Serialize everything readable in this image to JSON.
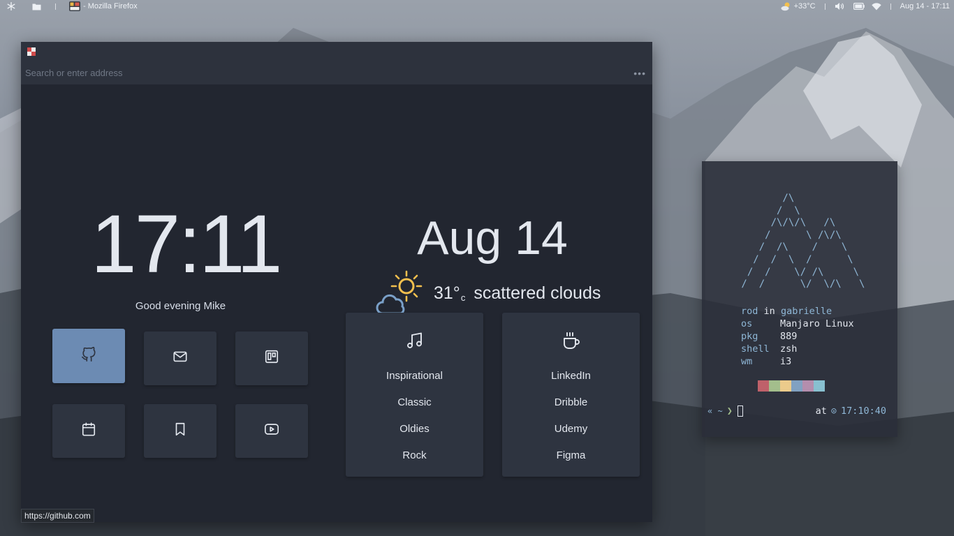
{
  "topbar": {
    "window_title": "- Mozilla Firefox",
    "weather": "+33°C",
    "datetime": "Aug 14 - 17:11"
  },
  "browser": {
    "url_placeholder": "Search or enter address",
    "menu_icon": "ellipsis-icon"
  },
  "newtab": {
    "clock": "17:11",
    "greeting": "Good evening Mike",
    "date": "Aug 14",
    "temperature": "31°",
    "temperature_unit": "c",
    "condition": "scattered clouds",
    "shortcuts": [
      {
        "icon": "github-icon",
        "active": true
      },
      {
        "icon": "mail-icon"
      },
      {
        "icon": "trello-icon"
      },
      {
        "icon": "calendar-icon"
      },
      {
        "icon": "bookmark-icon"
      },
      {
        "icon": "youtube-icon"
      }
    ],
    "music_card": {
      "icon": "music-note-icon",
      "links": [
        "Inspirational",
        "Classic",
        "Oldies",
        "Rock"
      ]
    },
    "work_card": {
      "icon": "coffee-cup-icon",
      "links": [
        "LinkedIn",
        "Dribble",
        "Udemy",
        "Figma"
      ]
    }
  },
  "status": {
    "hover_url": "https://github.com"
  },
  "terminal": {
    "user": "rod",
    "in_word": "in",
    "host": "gabrielle",
    "rows": [
      {
        "key": "os",
        "value": "Manjaro Linux"
      },
      {
        "key": "pkg",
        "value": "889"
      },
      {
        "key": "shell",
        "value": "zsh"
      },
      {
        "key": "wm",
        "value": "i3"
      }
    ],
    "palette": [
      "#bf616a",
      "#a3be8c",
      "#ebcb8b",
      "#81a1c1",
      "#b48ead",
      "#88c0d0"
    ],
    "prompt_symbol": "« ~",
    "prompt_arrow": "❯",
    "at_word": "at",
    "clock_symbol": "⊙",
    "time": "17:10:40"
  },
  "colors": {
    "accent": "#6c8bb3",
    "tile": "#2e3440",
    "window_bg": "#222630",
    "ascii": "#8fb7d6"
  }
}
